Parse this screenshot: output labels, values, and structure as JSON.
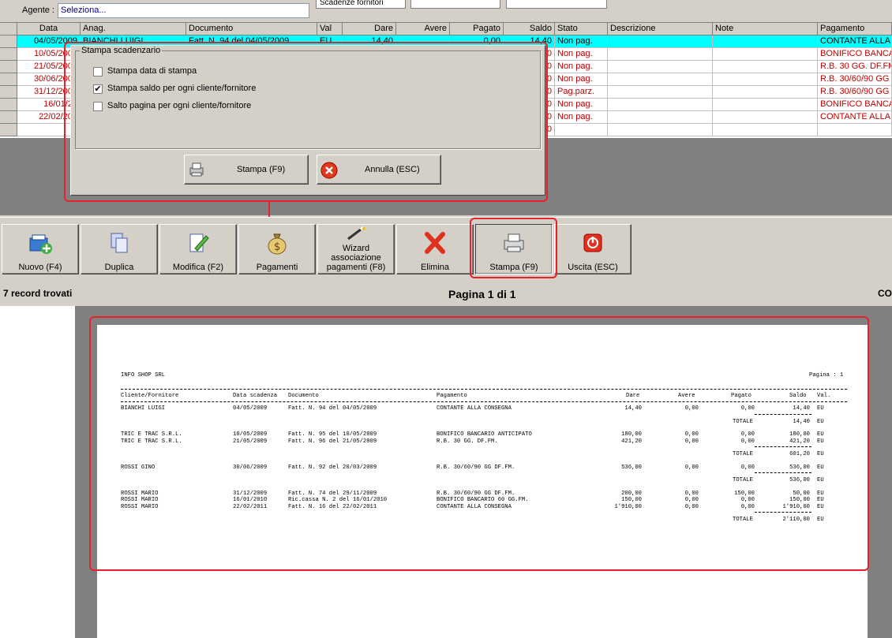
{
  "top": {
    "agent_label": "Agente :",
    "agent_value": "Seleziona...",
    "field1": "Scadenze fornitori"
  },
  "grid": {
    "headers": [
      "Data",
      "Anag.",
      "Documento",
      "Val",
      "Dare",
      "Avere",
      "Pagato",
      "Saldo",
      "Stato",
      "Descrizione",
      "Note",
      "Pagamento"
    ],
    "rows": [
      {
        "data": "04/05/2009",
        "anag": "BIANCHI LUIGI",
        "doc": "Fatt. N. 94 del 04/05/2009",
        "val": "EU",
        "dare": "14,40",
        "avere": "",
        "pagato": "0,00",
        "saldo": "14,40",
        "stato": "Non pag.",
        "pag": "CONTANTE ALLA"
      },
      {
        "data": "10/05/2009",
        "anag": "",
        "doc": "",
        "val": "",
        "dare": "",
        "avere": "",
        "pagato": "",
        "saldo": "30",
        "stato": "Non pag.",
        "pag": "BONIFICO BANCAI"
      },
      {
        "data": "21/05/2009",
        "anag": "",
        "doc": "",
        "val": "",
        "dare": "",
        "avere": "",
        "pagato": "",
        "saldo": "20",
        "stato": "Non pag.",
        "pag": "R.B. 30 GG. DF.FM"
      },
      {
        "data": "30/06/2009",
        "anag": "",
        "doc": "",
        "val": "",
        "dare": "",
        "avere": "",
        "pagato": "",
        "saldo": "30",
        "stato": "Non pag.",
        "pag": "R.B. 30/60/90 GG"
      },
      {
        "data": "31/12/2009",
        "anag": "",
        "doc": "",
        "val": "",
        "dare": "",
        "avere": "",
        "pagato": "",
        "saldo": "30",
        "stato": "Pag.parz.",
        "pag": "R.B. 30/60/90 GG"
      },
      {
        "data": "16/01/20",
        "anag": "",
        "doc": "",
        "val": "",
        "dare": "",
        "avere": "",
        "pagato": "",
        "saldo": "30",
        "stato": "Non pag.",
        "pag": "BONIFICO BANCAI"
      },
      {
        "data": "22/02/201",
        "anag": "",
        "doc": "",
        "val": "",
        "dare": "",
        "avere": "",
        "pagato": "",
        "saldo": "30",
        "stato": "Non pag.",
        "pag": "CONTANTE ALLA"
      },
      {
        "data": "",
        "anag": "",
        "doc": "",
        "val": "",
        "dare": "",
        "avere": "",
        "pagato": "",
        "saldo": "30",
        "stato": "",
        "pag": ""
      }
    ]
  },
  "dialog": {
    "title": "Stampa scadenzario",
    "opt1": "Stampa data di stampa",
    "opt2": "Stampa saldo per ogni cliente/fornitore",
    "opt3": "Salto pagina per ogni cliente/fornitore",
    "opt2_checked": "✔",
    "print_label": "Stampa (F9)",
    "cancel_label": "Annulla (ESC)"
  },
  "toolbar": {
    "nuovo": "Nuovo (F4)",
    "duplica": "Duplica",
    "modifica": "Modifica (F2)",
    "pagamenti": "Pagamenti",
    "wizard": "Wizard associazione pagamenti (F8)",
    "elimina": "Elimina",
    "stampa": "Stampa (F9)",
    "uscita": "Uscita (ESC)"
  },
  "status": {
    "records": "7 record trovati",
    "page": "Pagina 1 di 1",
    "right": "CO"
  },
  "report": {
    "company": "INFO SHOP SRL",
    "page_label": "Pagina : 1",
    "headers": {
      "cliente": "Cliente/Fornitore",
      "data": "Data scadenza",
      "doc": "Documento",
      "pag": "Pagamento",
      "dare": "Dare",
      "avere": "Avere",
      "pagato": "Pagato",
      "saldo": "Saldo",
      "val": "Val."
    },
    "totale_label": "TOTALE",
    "groups": [
      {
        "rows": [
          {
            "cliente": "BIANCHI LUIGI",
            "data": "04/05/2009",
            "doc": "Fatt. N. 94 del 04/05/2009",
            "pag": "CONTANTE ALLA CONSEGNA",
            "dare": "14,40",
            "avere": "0,00",
            "pagato": "0,00",
            "saldo": "14,40",
            "val": "EU"
          }
        ],
        "totale": "14,40",
        "val": "EU"
      },
      {
        "rows": [
          {
            "cliente": "TRIC E TRAC S.R.L.",
            "data": "10/05/2009",
            "doc": "Fatt. N. 95 del 10/05/2009",
            "pag": "BONIFICO BANCARIO ANTICIPATO",
            "dare": "180,00",
            "avere": "0,00",
            "pagato": "0,00",
            "saldo": "180,00",
            "val": "EU"
          },
          {
            "cliente": "TRIC E TRAC S.R.L.",
            "data": "21/05/2009",
            "doc": "Fatt. N. 96 del 21/05/2009",
            "pag": "R.B. 30 GG. DF.FM.",
            "dare": "421,20",
            "avere": "0,00",
            "pagato": "0,00",
            "saldo": "421,20",
            "val": "EU"
          }
        ],
        "totale": "601,20",
        "val": "EU"
      },
      {
        "rows": [
          {
            "cliente": "ROSSI GINO",
            "data": "30/06/2009",
            "doc": "Fatt. N. 92 del 20/03/2009",
            "pag": "R.B. 30/60/90 GG DF.FM.",
            "dare": "536,00",
            "avere": "0,00",
            "pagato": "0,00",
            "saldo": "536,00",
            "val": "EU"
          }
        ],
        "totale": "536,00",
        "val": "EU"
      },
      {
        "rows": [
          {
            "cliente": "ROSSI MARIO",
            "data": "31/12/2009",
            "doc": "Fatt. N. 74 del 29/11/2009",
            "pag": "R.B. 30/60/90 GG DF.FM.",
            "dare": "200,00",
            "avere": "0,00",
            "pagato": "150,00",
            "saldo": "50,00",
            "val": "EU"
          },
          {
            "cliente": "ROSSI MARIO",
            "data": "16/01/2010",
            "doc": "Ric.cassa N. 2 del 16/01/2010",
            "pag": "BONIFICO BANCARIO 60 GG.FM.",
            "dare": "150,00",
            "avere": "0,00",
            "pagato": "0,00",
            "saldo": "150,00",
            "val": "EU"
          },
          {
            "cliente": "ROSSI MARIO",
            "data": "22/02/2011",
            "doc": "Fatt. N. 16 del 22/02/2011",
            "pag": "CONTANTE ALLA CONSEGNA",
            "dare": "1'910,00",
            "avere": "0,00",
            "pagato": "0,00",
            "saldo": "1'910,00",
            "val": "EU"
          }
        ],
        "totale": "2'110,00",
        "val": "EU"
      }
    ]
  },
  "colors": {
    "highlight": "#00ffff",
    "due": "#c00000",
    "annotation": "#e8202a"
  }
}
